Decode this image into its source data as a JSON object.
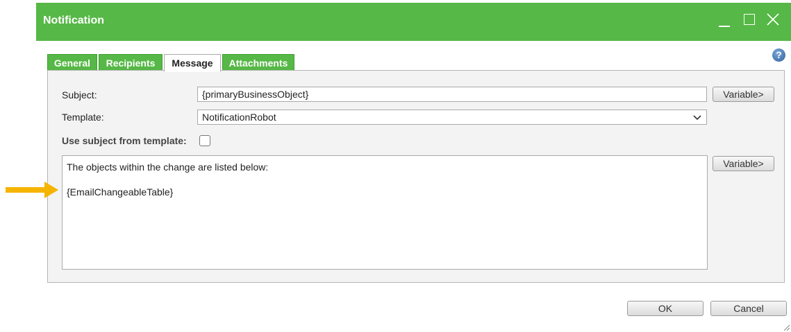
{
  "window": {
    "title": "Notification"
  },
  "tabs": [
    {
      "label": "General"
    },
    {
      "label": "Recipients"
    },
    {
      "label": "Message"
    },
    {
      "label": "Attachments"
    }
  ],
  "form": {
    "subject_label": "Subject:",
    "subject_value": "{primaryBusinessObject}",
    "template_label": "Template:",
    "template_value": "NotificationRobot",
    "use_subject_label": "Use subject from template:",
    "use_subject_checked": false,
    "variable_button": "Variable>",
    "body_lines": [
      "The objects within the change are listed below:",
      "{EmailChangeableTable}"
    ]
  },
  "footer": {
    "ok": "OK",
    "cancel": "Cancel"
  },
  "colors": {
    "accent": "#56b846",
    "pointer_arrow": "#f5b400"
  }
}
